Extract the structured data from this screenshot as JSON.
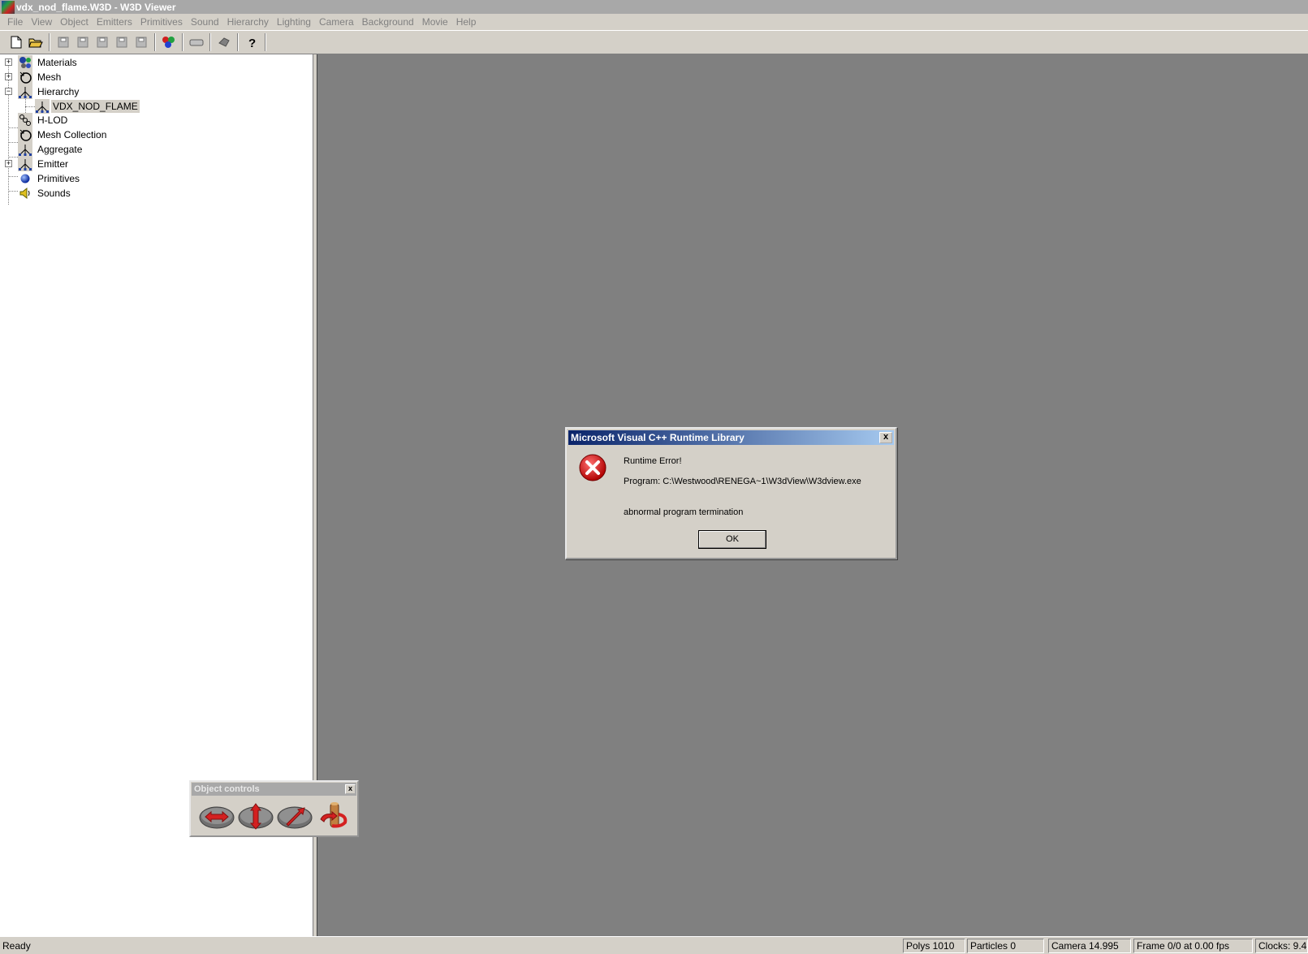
{
  "window": {
    "title": "vdx_nod_flame.W3D - W3D Viewer"
  },
  "menu": [
    "File",
    "View",
    "Object",
    "Emitters",
    "Primitives",
    "Sound",
    "Hierarchy",
    "Lighting",
    "Camera",
    "Background",
    "Movie",
    "Help"
  ],
  "toolbar": {
    "buttons": [
      "new-file-icon",
      "open-folder-icon",
      "save-icon",
      "save-icon",
      "save-icon",
      "save-icon",
      "save-icon",
      "color-picker-icon",
      "eraser-icon",
      "pointer-icon",
      "help-icon"
    ]
  },
  "tree": {
    "items": [
      {
        "label": "Materials",
        "icon": "materials-icon",
        "expander": "+"
      },
      {
        "label": "Mesh",
        "icon": "mesh-icon",
        "expander": "+"
      },
      {
        "label": "Hierarchy",
        "icon": "hierarchy-icon",
        "expander": "−"
      },
      {
        "label": "VDX_NOD_FLAME",
        "icon": "hierarchy-icon",
        "selected": true
      },
      {
        "label": "H-LOD",
        "icon": "hlod-icon"
      },
      {
        "label": "Mesh Collection",
        "icon": "mesh-collection-icon"
      },
      {
        "label": "Aggregate",
        "icon": "aggregate-icon"
      },
      {
        "label": "Emitter",
        "icon": "emitter-icon",
        "expander": "+"
      },
      {
        "label": "Primitives",
        "icon": "primitives-icon"
      },
      {
        "label": "Sounds",
        "icon": "sound-icon"
      }
    ]
  },
  "dialog": {
    "title": "Microsoft Visual C++ Runtime Library",
    "close": "x",
    "line1": "Runtime Error!",
    "line2": "Program: C:\\Westwood\\RENEGA~1\\W3dView\\W3dview.exe",
    "line3": "abnormal program termination",
    "ok": "OK"
  },
  "object_controls": {
    "title": "Object controls",
    "close": "x"
  },
  "status": {
    "ready": "Ready",
    "polys": "Polys 1010",
    "particles": "Particles 0",
    "camera": "Camera 14.995",
    "frame": "Frame 0/0 at 0.00 fps",
    "clocks": "Clocks: 9.4"
  },
  "colors": {
    "dialog_title_start": "#0a246a",
    "viewport": "#808080",
    "error_red": "#d42020"
  }
}
